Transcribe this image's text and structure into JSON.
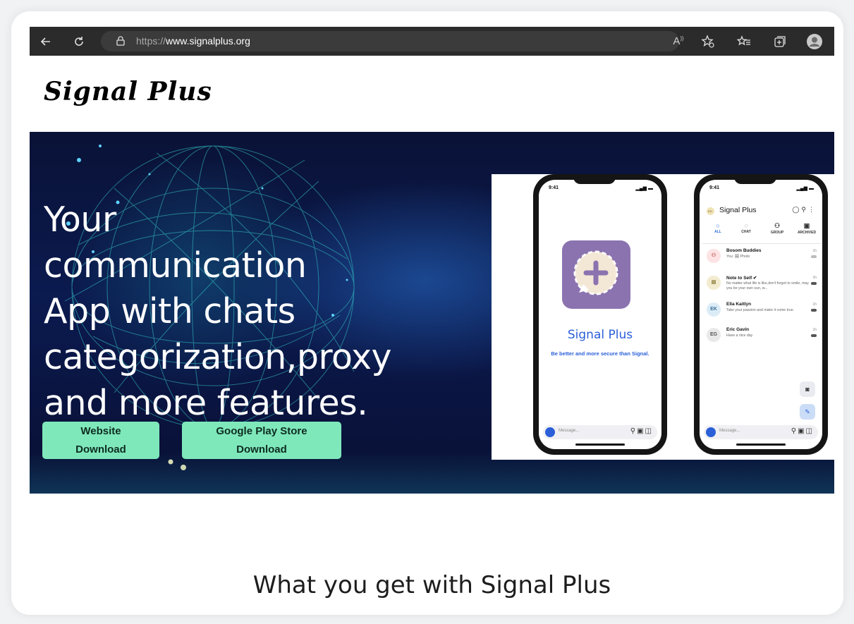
{
  "browser": {
    "url_scheme": "https://",
    "url_host": "www.signalplus.org",
    "read_aloud_label": "A",
    "read_aloud_sup": "))"
  },
  "site": {
    "logo": "Signal Plus"
  },
  "hero": {
    "headline": [
      "Your",
      "communication",
      "App with chats",
      "categorization,proxy",
      "and more features."
    ],
    "cta_website": [
      "Website",
      "Download"
    ],
    "cta_play": [
      "Google Play Store",
      "Download"
    ]
  },
  "phone_left": {
    "time": "9:41",
    "signal": "▂▄▆ ▬",
    "app_name": "Signal  Plus",
    "tagline": "Be better and more secure than Signal.",
    "message_placeholder": "Message..."
  },
  "phone_right": {
    "time": "9:41",
    "signal": "▂▄▆ ▬",
    "avatar_label": "EH",
    "title": "Signal  Plus",
    "tabs": [
      {
        "glyph": "○",
        "label": "ALL",
        "active": true
      },
      {
        "glyph": "◌",
        "label": "CHAT",
        "active": false
      },
      {
        "glyph": "⚇",
        "label": "GROUP",
        "active": false
      },
      {
        "glyph": "▣",
        "label": "ARCHIVED",
        "active": false
      }
    ],
    "chats": [
      {
        "initials": "⚇",
        "name": "Bosom Buddies",
        "preview": "You: 🖼 Photo",
        "time": "1h",
        "bg": "#fde3e3",
        "fg": "#c25555"
      },
      {
        "initials": "▤",
        "name": "Note to Self ✔",
        "preview": "No matter what life is like,don't  forget to smile, may you be your own sun, w...",
        "time": "1h",
        "bg": "#f3ecd0",
        "fg": "#8a7a3a"
      },
      {
        "initials": "EK",
        "name": "Ella Kaitlyn",
        "preview": "Take your passion and make it come true.",
        "time": "1h",
        "bg": "#dcecf7",
        "fg": "#3a6f9a"
      },
      {
        "initials": "EG",
        "name": "Eric Gavin",
        "preview": "Have a nice day",
        "time": "1h",
        "bg": "#e9e9e9",
        "fg": "#555555"
      }
    ],
    "message_placeholder": "Message..."
  },
  "section": {
    "title": "What you get with Signal Plus"
  },
  "colors": {
    "cta_bg": "#7fe8bb",
    "hero_bg": "#0b1a4f",
    "brand_blue": "#2a5fd8",
    "app_icon": "#8b73b0"
  },
  "icons": [
    "back-arrow-icon",
    "refresh-icon",
    "lock-icon",
    "read-aloud-icon",
    "favorite-add-icon",
    "favorites-icon",
    "collections-icon",
    "profile-avatar-icon"
  ]
}
